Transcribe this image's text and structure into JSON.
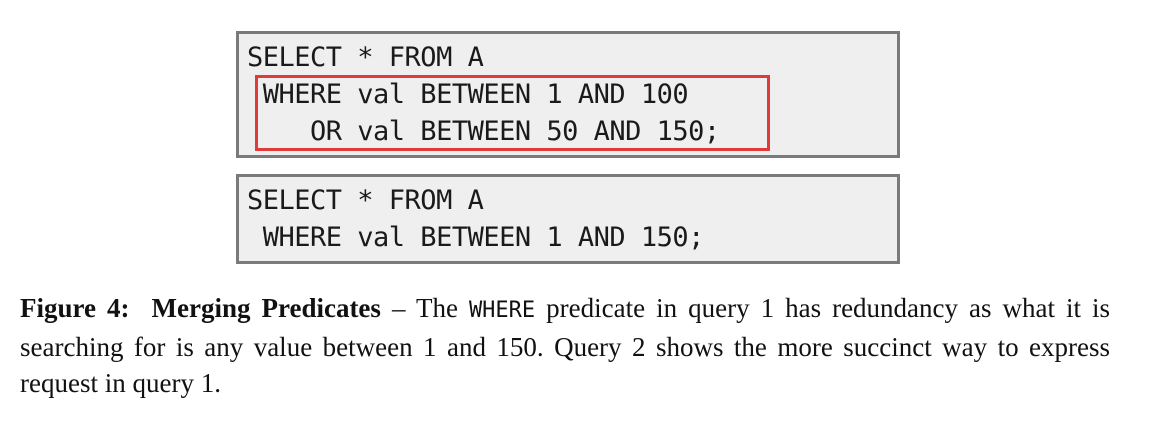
{
  "query1": {
    "lines": [
      "SELECT * FROM A",
      " WHERE val BETWEEN 1 AND 100",
      "    OR val BETWEEN 50 AND 150;"
    ]
  },
  "query2": {
    "lines": [
      "SELECT * FROM A",
      " WHERE val BETWEEN 1 AND 150;"
    ]
  },
  "caption": {
    "label": "Figure 4:",
    "title": "Merging Predicates",
    "dash": " – The ",
    "keyword": "WHERE",
    "text_line1_rest": " predicate in query 1 has redundancy as what it is searching for is any value between 1 and 150.  Query 2 shows the more succinct way to express request in query 1."
  },
  "colors": {
    "highlight_border": "#e03a3a",
    "box_border": "#7a7a7a",
    "box_background": "#efefef"
  }
}
